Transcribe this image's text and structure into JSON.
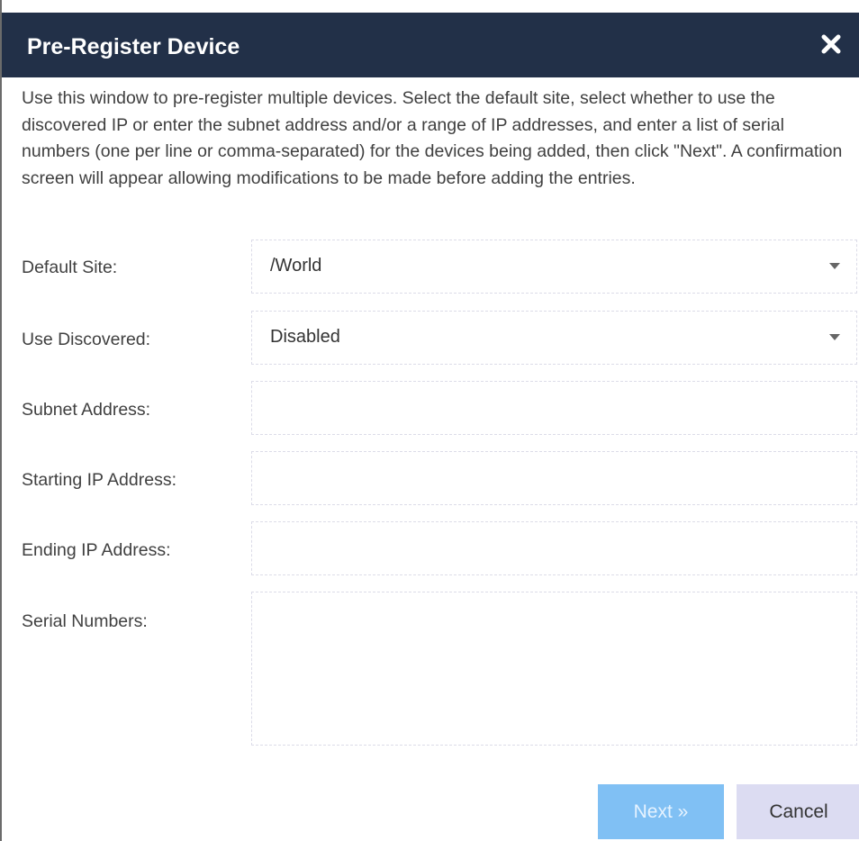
{
  "dialog": {
    "title": "Pre-Register Device",
    "description": "Use this window to pre-register multiple devices. Select the default site, select whether to use the discovered IP or enter the subnet address and/or a range of IP addresses, and enter a list of serial numbers (one per line or comma-separated) for the devices being added, then click \"Next\". A confirmation screen will appear allowing modifications to be made before adding the entries."
  },
  "form": {
    "default_site": {
      "label": "Default Site:",
      "value": "/World"
    },
    "use_discovered": {
      "label": "Use Discovered:",
      "value": "Disabled"
    },
    "subnet_address": {
      "label": "Subnet Address:",
      "value": ""
    },
    "starting_ip": {
      "label": "Starting IP Address:",
      "value": ""
    },
    "ending_ip": {
      "label": "Ending IP Address:",
      "value": ""
    },
    "serial_numbers": {
      "label": "Serial Numbers:",
      "value": ""
    }
  },
  "buttons": {
    "next": "Next »",
    "cancel": "Cancel"
  },
  "icons": {
    "close": "close-icon",
    "dropdown": "chevron-down-icon"
  },
  "colors": {
    "titlebar": "#223048",
    "next_button": "#80c0f4",
    "cancel_button": "#dcdcf2"
  }
}
